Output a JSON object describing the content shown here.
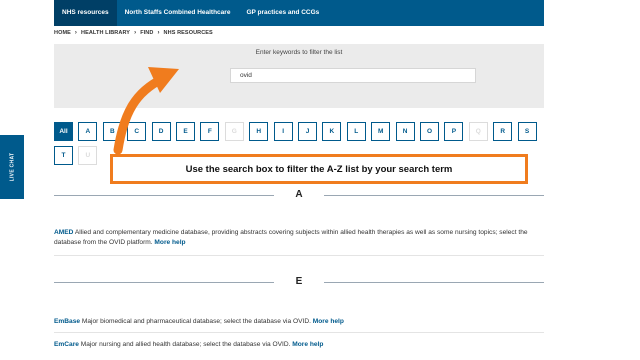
{
  "nav": {
    "tabs": [
      {
        "label": "NHS resources",
        "active": true
      },
      {
        "label": "North Staffs Combined Healthcare"
      },
      {
        "label": "GP practices and CCGs"
      }
    ]
  },
  "breadcrumb": {
    "items": [
      "HOME",
      "HEALTH LIBRARY",
      "FIND",
      "NHS RESOURCES"
    ],
    "separator": "›"
  },
  "filter": {
    "label": "Enter keywords to filter the list",
    "value": "ovid"
  },
  "letters": [
    {
      "label": "All",
      "state": "active"
    },
    {
      "label": "A",
      "state": "enabled"
    },
    {
      "label": "B",
      "state": "enabled"
    },
    {
      "label": "C",
      "state": "enabled"
    },
    {
      "label": "D",
      "state": "enabled"
    },
    {
      "label": "E",
      "state": "enabled"
    },
    {
      "label": "F",
      "state": "enabled"
    },
    {
      "label": "G",
      "state": "disabled"
    },
    {
      "label": "H",
      "state": "enabled"
    },
    {
      "label": "I",
      "state": "enabled"
    },
    {
      "label": "J",
      "state": "enabled"
    },
    {
      "label": "K",
      "state": "enabled"
    },
    {
      "label": "L",
      "state": "enabled"
    },
    {
      "label": "M",
      "state": "enabled"
    },
    {
      "label": "N",
      "state": "enabled"
    },
    {
      "label": "O",
      "state": "enabled"
    },
    {
      "label": "P",
      "state": "enabled"
    },
    {
      "label": "Q",
      "state": "disabled"
    },
    {
      "label": "R",
      "state": "enabled"
    },
    {
      "label": "S",
      "state": "enabled"
    },
    {
      "label": "T",
      "state": "enabled"
    },
    {
      "label": "U",
      "state": "disabled"
    }
  ],
  "sections": [
    {
      "letter": "A",
      "entries": [
        {
          "name": "AMED",
          "description": " Allied and complementary medicine database, providing abstracts covering subjects within allied health therapies as well as some nursing topics; select the database from the OVID platform. ",
          "more": "More help"
        }
      ]
    },
    {
      "letter": "E",
      "entries": [
        {
          "name": "EmBase",
          "description": " Major biomedical and pharmaceutical database; select the database via OVID. ",
          "more": "More help"
        },
        {
          "name": "EmCare",
          "description": " Major nursing and allied health database; select the database via OVID. ",
          "more": "More help"
        }
      ]
    }
  ],
  "livechat": {
    "label": "LIVE CHAT"
  },
  "callout": {
    "text": "Use the search box to filter the A-Z list by your search term"
  },
  "colors": {
    "brand": "#005a8c",
    "callout": "#f07c1e"
  }
}
